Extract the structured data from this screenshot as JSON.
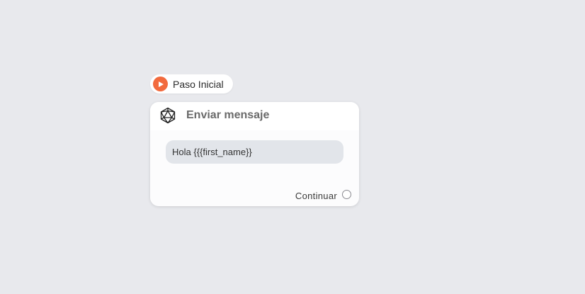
{
  "start_node": {
    "label": "Paso Inicial",
    "icon": "play-icon",
    "accent_color": "#f26a3d"
  },
  "node": {
    "title": "Enviar mensaje",
    "icon": "icosahedron-icon",
    "message": "Hola {{{first_name}}",
    "output_label": "Continuar"
  },
  "colors": {
    "canvas": "#e8e9ed",
    "card": "#fcfcfd",
    "bubble": "#e2e5ea"
  }
}
